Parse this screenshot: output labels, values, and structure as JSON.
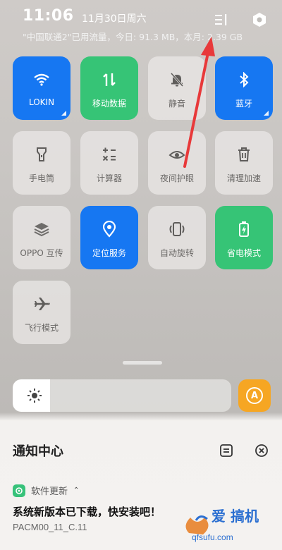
{
  "status": {
    "time": "11:06",
    "date": "11月30日周六",
    "traffic": "\"中国联通2\"已用流量，今日: 91.3 MB，本月: 2.39 GB"
  },
  "tiles": [
    {
      "label": "LOKIN",
      "state": "on",
      "color": "#1677f2",
      "icon": "wifi-icon"
    },
    {
      "label": "移动数据",
      "state": "on",
      "color": "#36c476",
      "icon": "mobile-data-icon"
    },
    {
      "label": "静音",
      "state": "off",
      "icon": "mute-bell-icon"
    },
    {
      "label": "蓝牙",
      "state": "on",
      "color": "#1677f2",
      "icon": "bluetooth-icon"
    },
    {
      "label": "手电筒",
      "state": "off",
      "icon": "flashlight-icon"
    },
    {
      "label": "计算器",
      "state": "off",
      "icon": "calculator-icon"
    },
    {
      "label": "夜间护眼",
      "state": "off",
      "icon": "eye-icon"
    },
    {
      "label": "清理加速",
      "state": "off",
      "icon": "trash-icon"
    },
    {
      "label": "OPPO 互传",
      "state": "off",
      "icon": "share-icon"
    },
    {
      "label": "定位服务",
      "state": "on",
      "color": "#1677f2",
      "icon": "location-icon"
    },
    {
      "label": "自动旋转",
      "state": "off",
      "icon": "rotate-icon"
    },
    {
      "label": "省电模式",
      "state": "on",
      "color": "#36c476",
      "icon": "battery-saver-icon"
    },
    {
      "label": "飞行模式",
      "state": "off",
      "icon": "airplane-icon"
    }
  ],
  "brightness": {
    "level": 0.17
  },
  "auto_brightness": {
    "label": "A",
    "color": "#f6a623"
  },
  "notifications": {
    "title": "通知中心",
    "app_name": "软件更新",
    "chevron": "⌃",
    "message": "系统新版本已下载，快安装吧！",
    "detail": "PACM00_11_C.11"
  },
  "watermark": {
    "text": "爱 搞机",
    "url": "qfsufu.com"
  }
}
